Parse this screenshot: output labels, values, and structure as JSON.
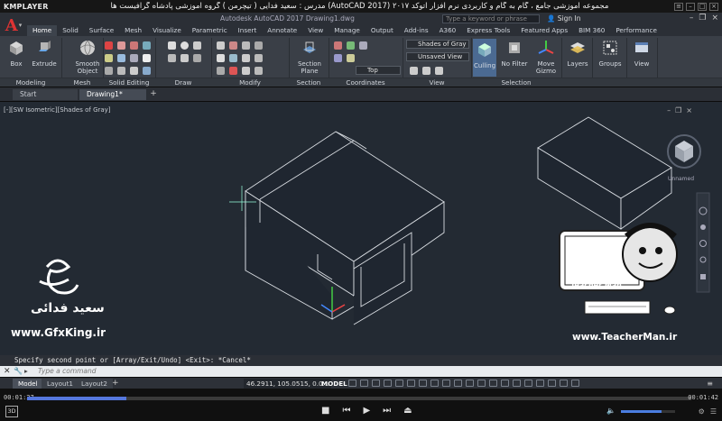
{
  "player": {
    "logo": "KMPLAYER",
    "title": "مجموعه آموزشی جامع ، گام به گام و کاربردی نرم افزار  اتوکد ۲۰۱۷ (AutoCAD 2017)  مدرس : سعید فدایی ( تیچرمن ) گروه آموزشی پادشاه گرافیست ها",
    "time_current": "00:01:27",
    "time_total": "00:01:42",
    "progress": 0.15,
    "volume": 0.75,
    "btn_3d": "3D"
  },
  "acad": {
    "doc_title": "Autodesk AutoCAD 2017   Drawing1.dwg",
    "search_placeholder": "Type a keyword or phrase",
    "sign_in": "Sign In"
  },
  "ribbon_tabs": [
    "Home",
    "Solid",
    "Surface",
    "Mesh",
    "Visualize",
    "Parametric",
    "Insert",
    "Annotate",
    "View",
    "Manage",
    "Output",
    "Add-ins",
    "A360",
    "Express Tools",
    "Featured Apps",
    "BIM 360",
    "Performance"
  ],
  "ribbon": {
    "box": "Box",
    "extrude": "Extrude",
    "smooth_object": "Smooth Object",
    "section_plane": "Section Plane",
    "culling": "Culling",
    "no_filter": "No Filter",
    "move_gizmo": "Move Gizmo",
    "layers": "Layers",
    "groups": "Groups",
    "view": "View",
    "visual_style": "Shades of Gray",
    "view_state": "Unsaved View",
    "ucs_view": "Top",
    "groups_labels": [
      "Modeling",
      "Mesh",
      "Solid Editing",
      "Draw",
      "Modify",
      "Section",
      "Coordinates",
      "View",
      "Selection"
    ]
  },
  "doc_tabs": [
    "Start",
    "Drawing1*"
  ],
  "viewport_label": "[-][SW Isometric][Shades of Gray]",
  "viewcube_label": "Unnamed",
  "command": {
    "history": "Specify second point or [Array/Exit/Undo] <Exit>: *Cancel*",
    "placeholder": "Type a command"
  },
  "status": {
    "layouts": [
      "Model",
      "Layout1",
      "Layout2"
    ],
    "coords": "46.2911, 105.0515, 0.0...",
    "model": "MODEL"
  },
  "watermark": {
    "site_left": "www.GfxKing.ir",
    "name": "سعید فدائی",
    "site_right": "www.TeacherMan.ir",
    "brand": "Teacher Man"
  },
  "colors": {
    "canvas": "#232a33",
    "ribbon": "#3a3f47",
    "accent": "#5577dd"
  }
}
